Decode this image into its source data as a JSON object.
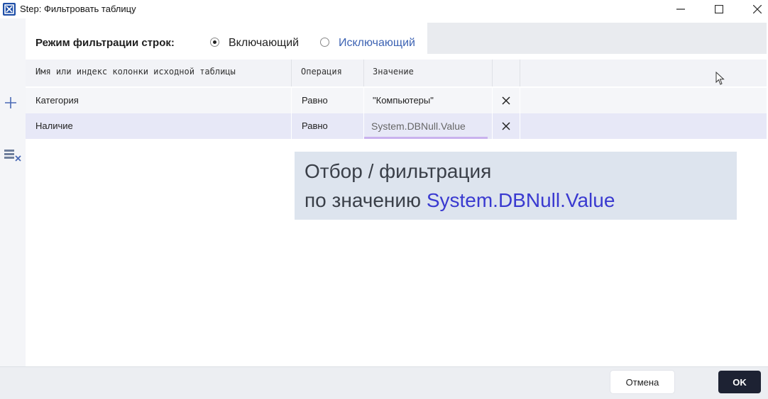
{
  "window": {
    "title": "Step: Фильтровать таблицу",
    "icon": "app-logo-icon"
  },
  "mode": {
    "label": "Режим фильтрации строк:",
    "options": [
      {
        "label": "Включающий",
        "selected": true
      },
      {
        "label": "Исключающий",
        "selected": false
      }
    ]
  },
  "grid": {
    "columns": [
      "Имя или индекс колонки исходной таблицы",
      "Операция",
      "Значение",
      ""
    ],
    "rows": [
      {
        "column": "Категория",
        "operation": "Равно",
        "value": "\"Компьютеры\"",
        "selected": false
      },
      {
        "column": "Наличие",
        "operation": "Равно",
        "value": "System.DBNull.Value",
        "selected": true
      }
    ]
  },
  "toolbar": {
    "add_icon": "plus-icon",
    "clear_icon": "clear-filter-icon"
  },
  "callout": {
    "line1": "Отбор / фильтрация",
    "line2_prefix": "по значению ",
    "line2_highlight": "System.DBNull.Value"
  },
  "footer": {
    "cancel_label": "Отмена",
    "ok_label": "OK"
  },
  "colors": {
    "selected_row": "#e7e8f7",
    "ok_button": "#1d2233",
    "callout_bg": "#dde4ee",
    "highlight_text": "#3a3ad0"
  }
}
